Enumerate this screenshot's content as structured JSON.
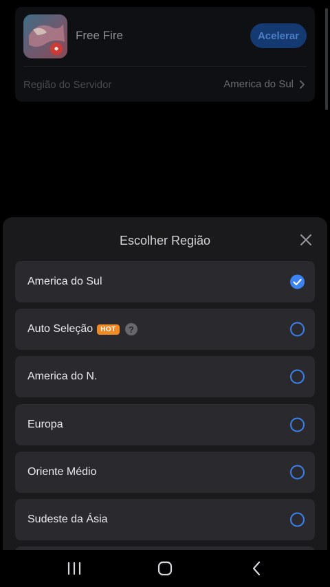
{
  "game": {
    "title": "Free Fire",
    "accelerate_label": "Acelerar",
    "server_label": "Região do Servidor",
    "server_value": "America do Sul",
    "icon": "free-fire-app-icon"
  },
  "region_sheet": {
    "title": "Escolher Região",
    "close_icon": "close-icon",
    "hot_badge": "HOT",
    "help_icon": "?",
    "items": [
      {
        "label": "America do Sul",
        "selected": true
      },
      {
        "label": "Auto Seleção",
        "selected": false,
        "badge": "HOT",
        "help": true
      },
      {
        "label": "America do N.",
        "selected": false
      },
      {
        "label": "Europa",
        "selected": false
      },
      {
        "label": "Oriente Médio",
        "selected": false
      },
      {
        "label": "Sudeste da Ásia",
        "selected": false
      }
    ]
  },
  "colors": {
    "accent": "#3c82f0",
    "hot_badge": "#f08a24",
    "sheet_bg": "#1a1a1d",
    "item_bg": "#2a2a2e"
  },
  "navigation": {
    "recent_icon": "recent-apps-icon",
    "home_icon": "home-icon",
    "back_icon": "back-icon"
  }
}
